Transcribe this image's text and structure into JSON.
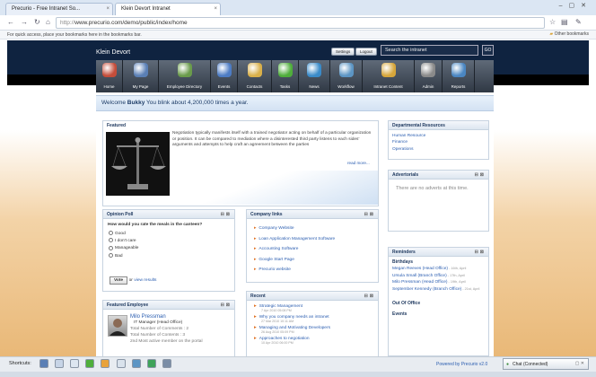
{
  "browser": {
    "tabs": [
      {
        "label": "Precurio - Free Intranet So...",
        "active": false
      },
      {
        "label": "Klein Devort Intranet",
        "active": true
      }
    ],
    "url_scheme": "http://",
    "url_rest": "www.precurio.com/demo/public/index/home",
    "bookmarks_hint": "For quick access, place your bookmarks here in the bookmarks bar.",
    "other_bookmarks": "Other bookmarks"
  },
  "header": {
    "brand": "Klein Devort",
    "settings": "Settings",
    "logout": "Logout",
    "search_placeholder": "Search the intranet",
    "go": "GO"
  },
  "menu": [
    {
      "label": "Home",
      "icon": "home-icon",
      "color": "#c44d3a"
    },
    {
      "label": "My Page",
      "icon": "my-page-icon",
      "color": "#5a7fb5"
    },
    {
      "label": "Employee Directory",
      "icon": "people-icon",
      "color": "#6a9b4b"
    },
    {
      "label": "Events",
      "icon": "calendar-icon",
      "color": "#4d7cc4"
    },
    {
      "label": "Contacts",
      "icon": "contacts-icon",
      "color": "#d9b04a"
    },
    {
      "label": "Tasks",
      "icon": "check-icon",
      "color": "#4fae3b"
    },
    {
      "label": "News",
      "icon": "globe-icon",
      "color": "#3a8bc9"
    },
    {
      "label": "Workflow",
      "icon": "workflow-icon",
      "color": "#5c95c4"
    },
    {
      "label": "Intranet Content",
      "icon": "content-icon",
      "color": "#d6a63b"
    },
    {
      "label": "Admin",
      "icon": "admin-icon",
      "color": "#8a8a8a"
    },
    {
      "label": "Reports",
      "icon": "reports-icon",
      "color": "#4a86c2"
    }
  ],
  "welcome": {
    "prefix": "Welcome",
    "user": "Bukky",
    "message": "You blink about 4,200,000 times a year."
  },
  "featured": {
    "title": "Featured",
    "text": "Negotiation typically manifests itself with a trained negotiator acting on behalf of a particular organization or position. It can be compared to mediation where a disinterested third party listens to each sides' arguments and attempts to help craft an agreement between the parties",
    "read_more": "read more..."
  },
  "departmental": {
    "title": "Departmental Resources",
    "items": [
      "Human Resource",
      "Finance",
      "Operations"
    ]
  },
  "adverts": {
    "title": "Advertorials",
    "empty": "There are no adverts at this time."
  },
  "opinion": {
    "title": "Opinion Poll",
    "question": "How would you rate the meals in the canteen?",
    "options": [
      "Good",
      "I don't care",
      "Manageable",
      "Bad"
    ],
    "vote": "Vote",
    "or": "or",
    "view_results": "view results"
  },
  "company_links": {
    "title": "Company links",
    "items": [
      "Company Website",
      "Loan Application Management Software",
      "Accounting Software",
      "Google Start Page",
      "Precurio website"
    ]
  },
  "reminders": {
    "title": "Reminders",
    "birthdays_title": "Birthdays",
    "birthdays": [
      {
        "name": "Megan Reeves (Head Office)",
        "date": "- 16th, April"
      },
      {
        "name": "Ursula Small (Branch Office)",
        "date": "- 17th, April"
      },
      {
        "name": "Milo Pressman (Head Office)",
        "date": "- 19th, April"
      },
      {
        "name": "September Kennedy (Branch Office)",
        "date": "- 21st, April"
      }
    ],
    "out_of_office": "Out Of Office",
    "events": "Events"
  },
  "featured_employee": {
    "title": "Featured Employee",
    "name": "Milo Pressman",
    "role": "IT Manager (Head Office)",
    "comments": "Total Number of Comments : 2",
    "contents": "Total Number of Contents : 3",
    "rank": "2nd Most active member on the portal"
  },
  "recent": {
    "title": "Recent",
    "items": [
      {
        "title": "Strategic Management",
        "date": "7 Apr 2010 05:08 PM"
      },
      {
        "title": "Why you company needs an intranet",
        "date": "27 Mar 2010 10:11 AM"
      },
      {
        "title": "Managing and Motivating Developers",
        "date": "26 Aug 2010 05:09 PM"
      },
      {
        "title": "Approaches to negotiation",
        "date": "10 Apr 2010 06:00 PM"
      }
    ]
  },
  "statusbar": {
    "shortcuts": "Shortcuts:",
    "powered": "Powered by Precurio v2.0",
    "chat": "Chat (Connected)"
  }
}
